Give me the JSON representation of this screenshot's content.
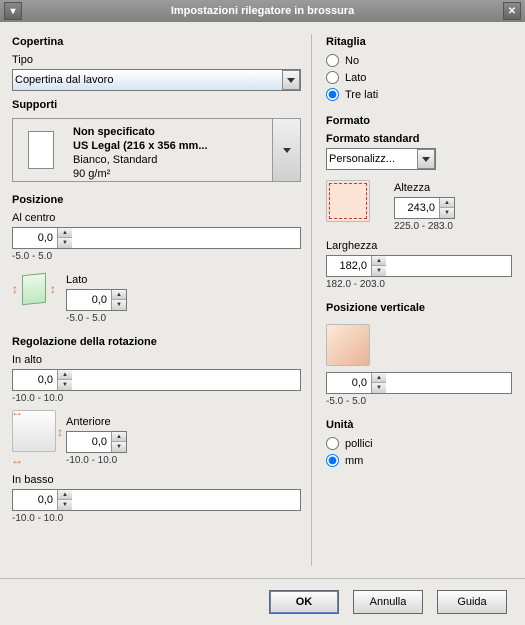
{
  "window": {
    "title": "Impostazioni rilegatore in brossura"
  },
  "cover": {
    "section": "Copertina",
    "type_label": "Tipo",
    "type_value": "Copertina dal lavoro",
    "media_label": "Supporti",
    "media": {
      "line1": "Non specificato",
      "line2": "US Legal (216 x 356 mm...",
      "line3": "Bianco, Standard",
      "line4": "90 g/m²"
    }
  },
  "position": {
    "section": "Posizione",
    "center_label": "Al centro",
    "center": {
      "value": "0,0",
      "range": "-5.0 - 5.0"
    },
    "side_label": "Lato",
    "side": {
      "value": "0,0",
      "range": "-5.0 - 5.0"
    }
  },
  "rotation": {
    "section": "Regolazione della rotazione",
    "top_label": "In alto",
    "top": {
      "value": "0,0",
      "range": "-10.0 - 10.0"
    },
    "front_label": "Anteriore",
    "front": {
      "value": "0,0",
      "range": "-10.0 - 10.0"
    },
    "bottom_label": "In basso",
    "bottom": {
      "value": "0,0",
      "range": "-10.0 - 10.0"
    }
  },
  "trim": {
    "section": "Ritaglia",
    "opt_no": "No",
    "opt_side": "Lato",
    "opt_three": "Tre lati",
    "selected": "Tre lati"
  },
  "format": {
    "section": "Formato",
    "std_label": "Formato standard",
    "std_value": "Personalizz...",
    "height_label": "Altezza",
    "height": {
      "value": "243,0",
      "range": "225.0 - 283.0"
    },
    "width_label": "Larghezza",
    "width": {
      "value": "182,0",
      "range": "182.0 - 203.0"
    }
  },
  "vpos": {
    "section": "Posizione verticale",
    "value": "0,0",
    "range": "-5.0 - 5.0"
  },
  "unit": {
    "section": "Unità",
    "opt_inches": "pollici",
    "opt_mm": "mm",
    "selected": "mm"
  },
  "footer": {
    "ok": "OK",
    "cancel": "Annulla",
    "help": "Guida"
  }
}
